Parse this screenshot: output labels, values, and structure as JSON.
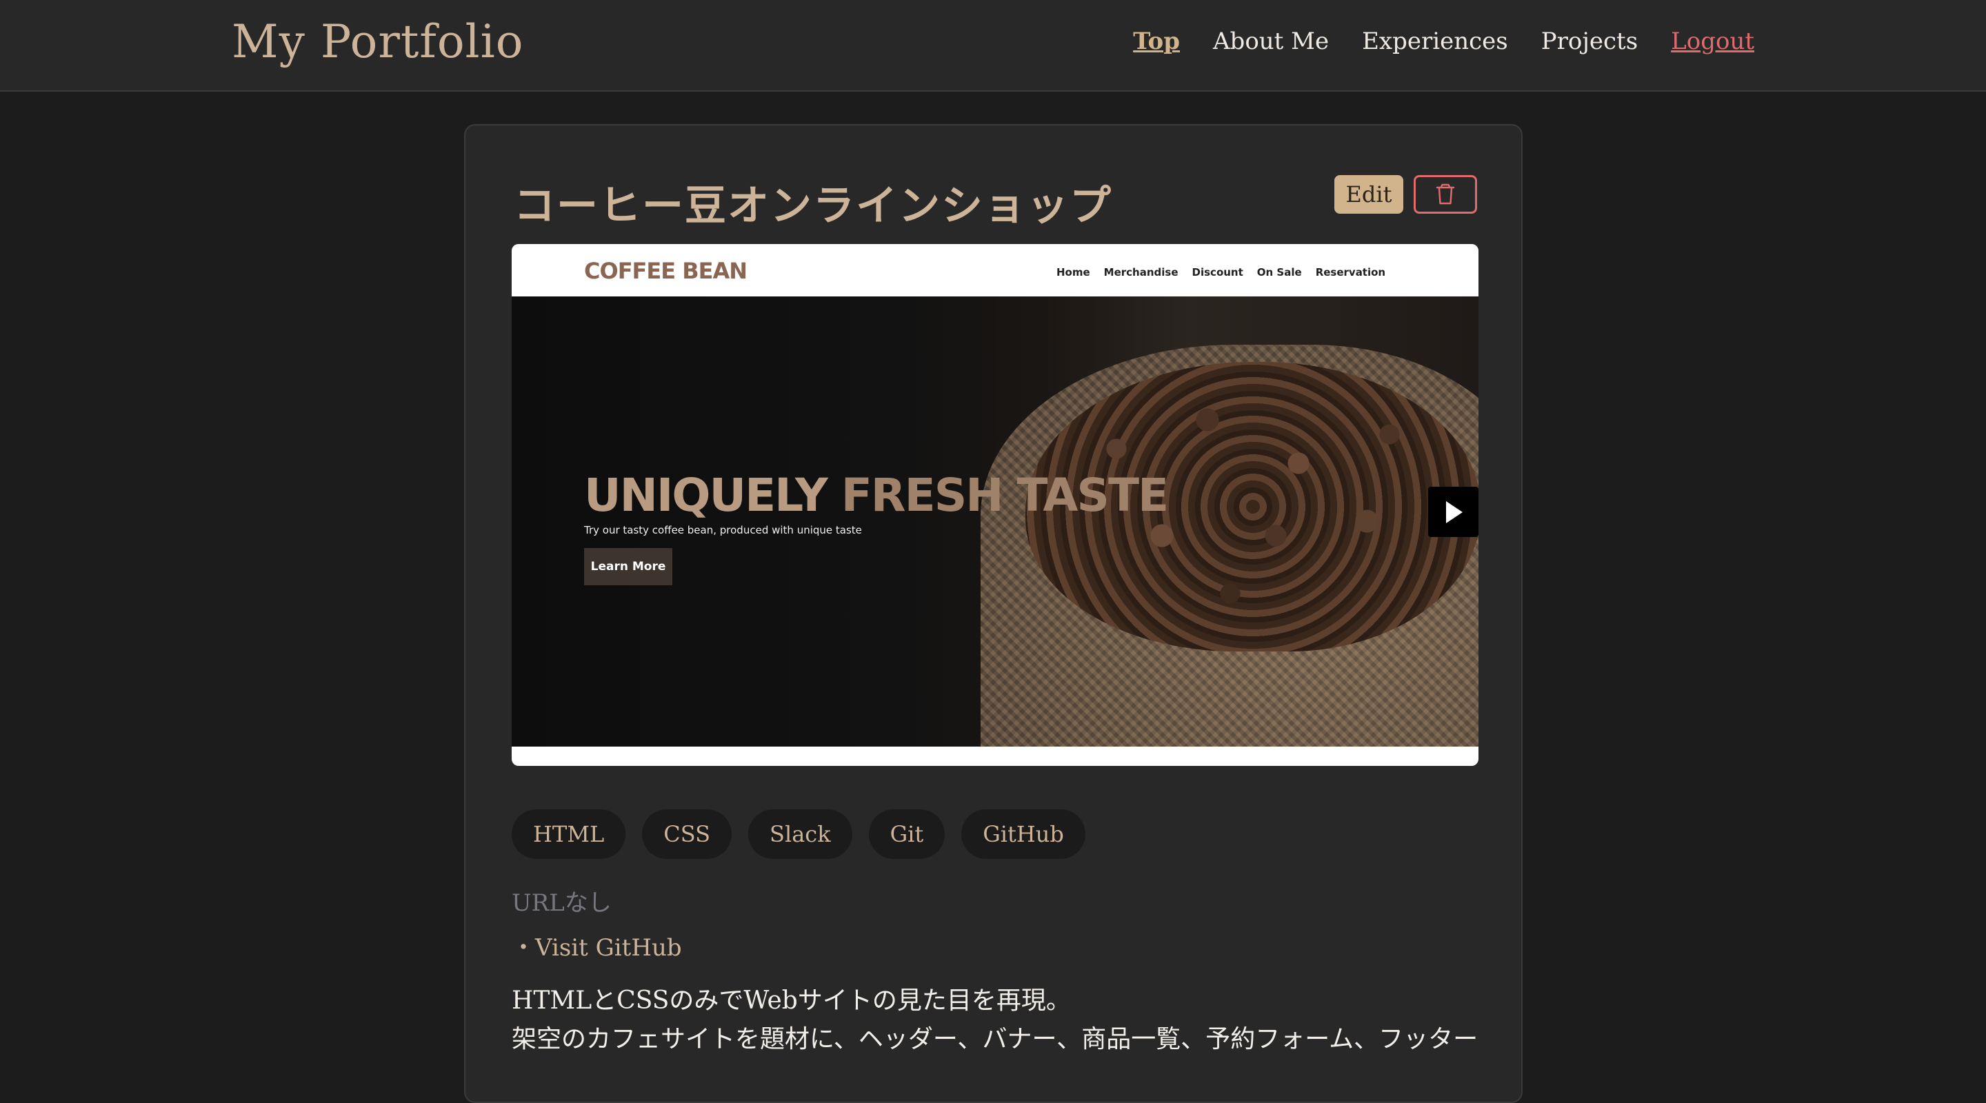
{
  "header": {
    "brand": "My Portfolio",
    "nav": [
      {
        "label": "Top",
        "active": true
      },
      {
        "label": "About Me"
      },
      {
        "label": "Experiences"
      },
      {
        "label": "Projects"
      },
      {
        "label": "Logout"
      }
    ]
  },
  "project": {
    "title": "コーヒー豆オンラインショップ",
    "edit_label": "Edit",
    "delete_icon": "trash-icon",
    "preview": {
      "logo": "COFFEE BEAN",
      "links": [
        "Home",
        "Merchandise",
        "Discount",
        "On Sale",
        "Reservation"
      ],
      "headline_part1": "UNIQUELY ",
      "headline_part2": "FRESH TASTE",
      "subtext": "Try our tasty coffee bean, produced with unique taste",
      "button": "Learn More",
      "play_icon": "play-icon"
    },
    "tags": [
      "HTML",
      "CSS",
      "Slack",
      "Git",
      "GitHub"
    ],
    "url_text": "URLなし",
    "github_link": "・Visit GitHub",
    "description": [
      "HTMLとCSSのみでWebサイトの見た目を再現。",
      "架空のカフェサイトを題材に、ヘッダー、バナー、商品一覧、予約フォーム、フッター"
    ]
  },
  "colors": {
    "accent": "#cdb397",
    "edit_bg": "#d2b48c",
    "danger": "#e06b6b",
    "background": "#1c1c1c",
    "card": "#282828"
  }
}
